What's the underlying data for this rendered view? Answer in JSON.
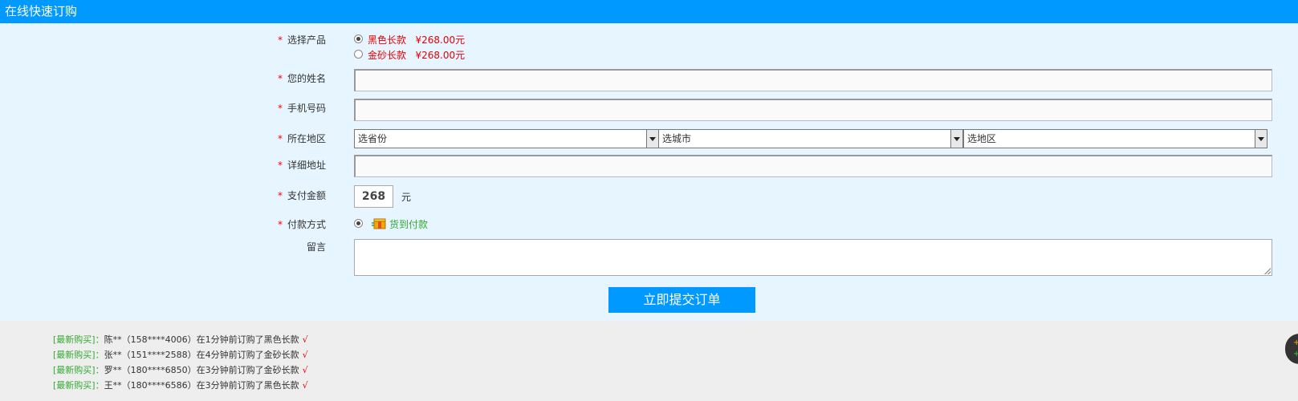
{
  "header": {
    "title": "在线快速订购"
  },
  "form": {
    "product": {
      "label": "选择产品",
      "options": [
        {
          "name": "黑色长款",
          "price": "¥268.00元",
          "selected": true
        },
        {
          "name": "金砂长款",
          "price": "¥268.00元",
          "selected": false
        }
      ]
    },
    "name": {
      "label": "您的姓名",
      "value": ""
    },
    "phone": {
      "label": "手机号码",
      "value": ""
    },
    "region": {
      "label": "所在地区",
      "province": "选省份",
      "city": "选城市",
      "district": "选地区"
    },
    "address": {
      "label": "详细地址",
      "value": ""
    },
    "amount": {
      "label": "支付金额",
      "value": "268",
      "unit": "元"
    },
    "payment": {
      "label": "付款方式",
      "method": "货到付款"
    },
    "message": {
      "label": "留言",
      "value": ""
    },
    "required_mark": "*",
    "submit_label": "立即提交订单"
  },
  "recent_orders": [
    {
      "tag": "[最新购买]：",
      "text": "陈**（158****4006）在1分钟前订购了黑色长款",
      "check": "√"
    },
    {
      "tag": "[最新购买]：",
      "text": "张**（151****2588）在4分钟前订购了金砂长款",
      "check": "√"
    },
    {
      "tag": "[最新购买]：",
      "text": "罗**（180****6850）在3分钟前订购了金砂长款",
      "check": "√"
    },
    {
      "tag": "[最新购买]：",
      "text": "王**（180****6586）在3分钟前订购了黑色长款",
      "check": "√"
    }
  ],
  "colors": {
    "accent": "#0099ff",
    "required": "#ff0000",
    "price": "#e60000",
    "tag": "#33aa33",
    "form_bg": "#e6f5ff"
  },
  "icons": {
    "payment": "cod-box-icon",
    "side": "floating-chat-icon"
  }
}
